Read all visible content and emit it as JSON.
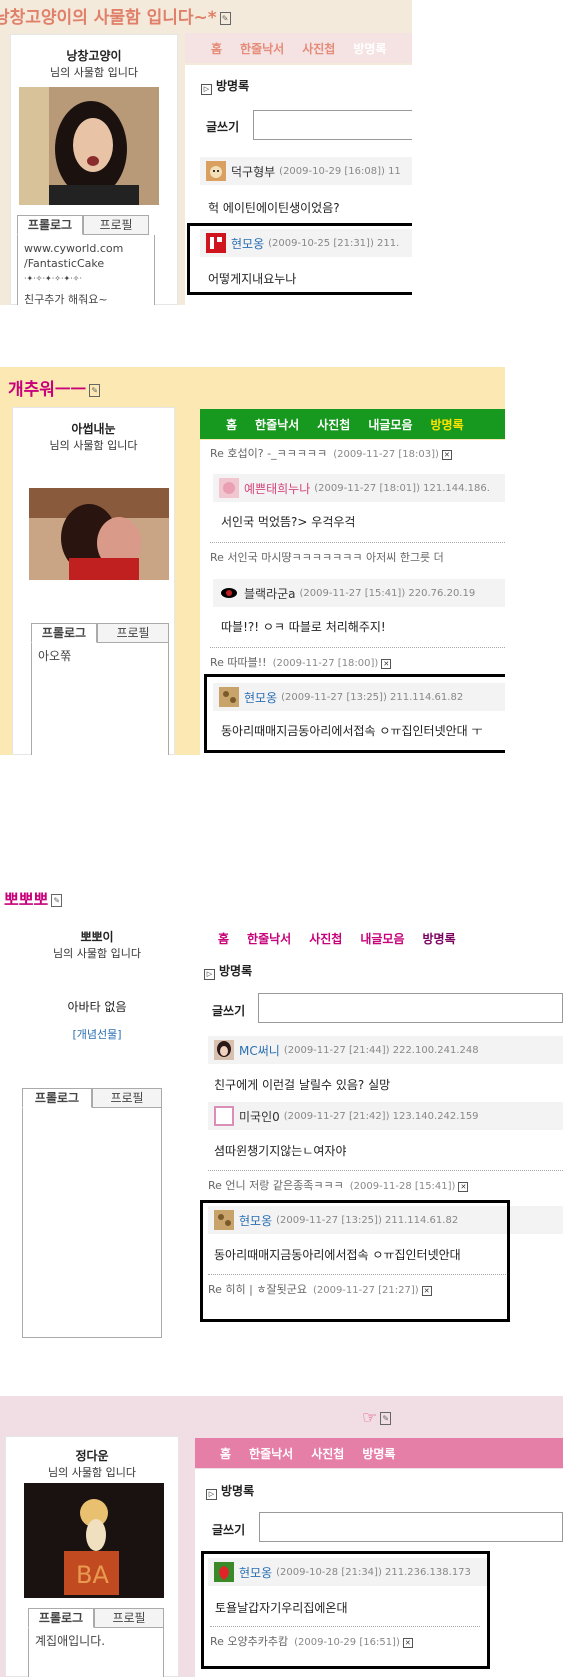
{
  "panel1": {
    "title": "낭창고양이의 사물함 입니다~*",
    "owner": "낭창고양이",
    "sub": "님의 사물함 입니다",
    "nav": [
      "홈",
      "한줄낙서",
      "사진첩",
      "방명록"
    ],
    "section": "방명록",
    "write_label": "글쓰기",
    "tabs": {
      "profile_log": "프롤로그",
      "profile": "프로필"
    },
    "profile_text": [
      "www.cyworld.com",
      "/FantasticCake",
      "·✦·✧·✦·✧·✦·✧·",
      "친구추가 해줘요~"
    ],
    "entries": [
      {
        "name": "덕구형부",
        "date": "(2009-10-29 [16:08]) 11",
        "text": "헉 에이틴에이틴생이었음?"
      },
      {
        "name": "현모옹",
        "date": "(2009-10-25 [21:31]) 211.",
        "text": "어떻게지내요누나"
      }
    ]
  },
  "panel2": {
    "title": "개추워ㅡㅡ",
    "owner": "아썹내눈",
    "sub": "님의 사물함 입니다",
    "nav": [
      "홈",
      "한줄낙서",
      "사진첩",
      "내글모음",
      "방명록"
    ],
    "tabs": {
      "profile_log": "프롤로그",
      "profile": "프로필"
    },
    "profile_text": [
      "아오쭊"
    ],
    "reply0": {
      "text": "Re 호섭이? -_ㅋㅋㅋㅋㅋ",
      "date": "(2009-11-27 [18:03])"
    },
    "entries": [
      {
        "name": "예쁜태희누나",
        "date": "(2009-11-27 [18:01]) 121.144.186.",
        "text": "서인국 먹었뜸?> 우걱우걱",
        "reply": "Re 서인국 마시땽ㅋㅋㅋㅋㅋㅋㅋ 아저씨 한그릇 더"
      },
      {
        "name": "블랙라군a",
        "date": "(2009-11-27 [15:41]) 220.76.20.19",
        "text": "따블!?! ㅇㅋ 따블로 처리해주지!",
        "reply": "Re 따따블!!",
        "reply_date": "(2009-11-27 [18:00])"
      },
      {
        "name": "현모옹",
        "date": "(2009-11-27 [13:25]) 211.114.61.82",
        "text": "동아리때매지금동아리에서접속 ㅇㅠ집인터넷안대 ㅜ"
      }
    ]
  },
  "panel3": {
    "title": "뽀뽀뽀",
    "owner": "뽀뽀이",
    "sub": "님의 사물함 입니다",
    "no_avatar": "아바타 없음",
    "gift": "[개념선물]",
    "nav": [
      "홈",
      "한줄낙서",
      "사진첩",
      "내글모음",
      "방명록"
    ],
    "section": "방명록",
    "write_label": "글쓰기",
    "tabs": {
      "profile_log": "프롤로그",
      "profile": "프로필"
    },
    "entries": [
      {
        "name": "MC써니",
        "date": "(2009-11-27 [21:44]) 222.100.241.248",
        "text": "친구에게 이런걸 날릴수 있음? 실망"
      },
      {
        "name": "미국인0",
        "date": "(2009-11-27 [21:42]) 123.140.242.159",
        "text": "셤따윈챙기지않는ㄴ여자야",
        "reply": "Re 언니 저랑 같은종족ㅋㅋㅋ",
        "reply_date": "(2009-11-28 [15:41])"
      },
      {
        "name": "현모옹",
        "date": "(2009-11-27 [13:25]) 211.114.61.82",
        "text": "동아리때매지금동아리에서접속 ㅇㅠ집인터넷안대",
        "reply": "Re 히히 | ㅎ잘됫군요",
        "reply_date": "(2009-11-27 [21:27])"
      }
    ]
  },
  "panel4": {
    "title_icon": "☞",
    "owner": "정다운",
    "sub": "님의 사물함 입니다",
    "nav": [
      "홈",
      "한줄낙서",
      "사진첩",
      "방명록"
    ],
    "section": "방명록",
    "write_label": "글쓰기",
    "tabs": {
      "profile_log": "프롤로그",
      "profile": "프로필"
    },
    "profile_text": [
      "계집애입니다."
    ],
    "entries": [
      {
        "name": "현모옹",
        "date": "(2009-10-28 [21:34]) 211.236.138.173",
        "text": "토욜날갑자기우리집에온대",
        "reply": "Re 오양추카추캄",
        "reply_date": "(2009-10-29 [16:51])"
      }
    ]
  },
  "colors": {
    "panel1_bg": "#f4eadb",
    "panel1_nav": "#f5e3e3",
    "panel1_title": "#e0806a",
    "panel2_bg": "#fbe8b3",
    "panel2_nav": "#17981f",
    "panel2_title": "#c8007a",
    "panel3_title": "#c8007a",
    "panel3_nav_text": "#c8007a",
    "panel4_bg": "#f1dde4",
    "panel4_nav": "#e67fa8"
  }
}
